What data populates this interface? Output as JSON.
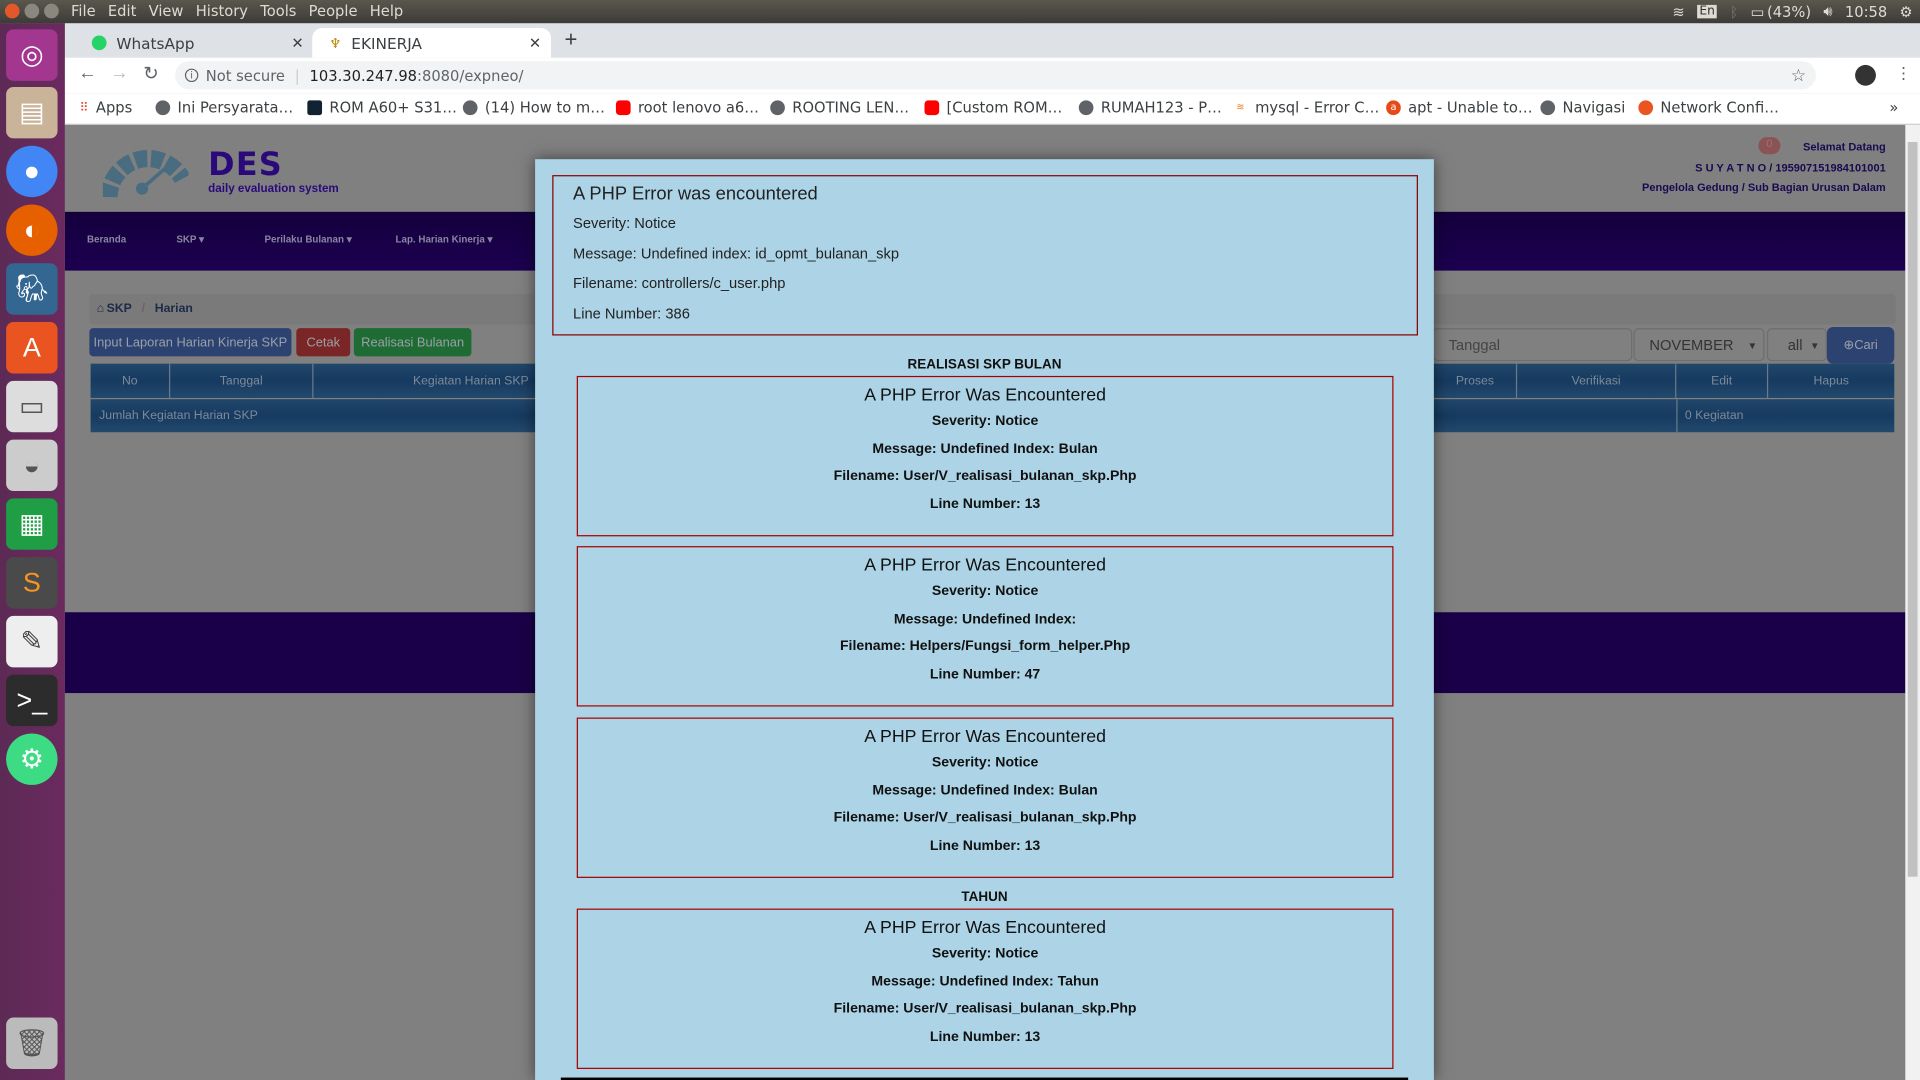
{
  "system": {
    "menu": [
      "File",
      "Edit",
      "View",
      "History",
      "Tools",
      "People",
      "Help"
    ],
    "keyboard": "En",
    "battery": "(43%)",
    "time": "10:58"
  },
  "browser": {
    "tabs": [
      {
        "label": "WhatsApp"
      },
      {
        "label": "EKINERJA"
      }
    ],
    "security": "Not secure",
    "url_host": "103.30.247.98",
    "url_rest": ":8080/expneo/",
    "bookmarks": [
      "Apps",
      "Ini Persyarata…",
      "ROM A60+ S31…",
      "(14) How to m…",
      "root lenovo a6…",
      "ROOTING LEN…",
      "[Custom ROM…",
      "RUMAH123 - P…",
      "mysql - Error C…",
      "apt - Unable to…",
      "Navigasi",
      "Network Confi…"
    ],
    "more": "»"
  },
  "site": {
    "logo_title": "DES",
    "logo_subtitle": "daily evaluation system",
    "badge": "0",
    "welcome": "Selamat Datang",
    "user": "S U Y A T N O / 195907151984101001",
    "position": "Pengelola Gedung / Sub Bagian Urusan Dalam",
    "nav": [
      "Beranda",
      "SKP",
      "Perilaku Bulanan",
      "Lap. Harian Kinerja"
    ],
    "breadcrumb": [
      "SKP",
      "Harian"
    ],
    "buttons": {
      "input": "Input Laporan Harian Kinerja SKP",
      "cetak": "Cetak",
      "realisasi": "Realisasi Bulanan",
      "cari": "Cari"
    },
    "filter": {
      "date_placeholder": "Tanggal",
      "month": "NOVEMBER",
      "status": "all"
    },
    "table": {
      "headers": [
        "No",
        "Tanggal",
        "Kegiatan Harian SKP",
        "Proses",
        "Verifikasi",
        "Edit",
        "Hapus"
      ],
      "footer_label": "Jumlah Kegiatan Harian SKP",
      "footer_count": "0 Kegiatan"
    }
  },
  "modal": {
    "top_error": {
      "title": "A PHP Error was encountered",
      "severity": "Severity: Notice",
      "message": "Message: Undefined index: id_opmt_bulanan_skp",
      "filename": "Filename: controllers/c_user.php",
      "line": "Line Number: 386"
    },
    "section1": "REALISASI SKP BULAN",
    "section2": "TAHUN",
    "errors": [
      {
        "title": "A PHP Error Was Encountered",
        "severity": "Severity: Notice",
        "message": "Message: Undefined Index: Bulan",
        "filename": "Filename: User/V_realisasi_bulanan_skp.Php",
        "line": "Line Number: 13"
      },
      {
        "title": "A PHP Error Was Encountered",
        "severity": "Severity: Notice",
        "message": "Message: Undefined Index:",
        "filename": "Filename: Helpers/Fungsi_form_helper.Php",
        "line": "Line Number: 47"
      },
      {
        "title": "A PHP Error Was Encountered",
        "severity": "Severity: Notice",
        "message": "Message: Undefined Index: Bulan",
        "filename": "Filename: User/V_realisasi_bulanan_skp.Php",
        "line": "Line Number: 13"
      },
      {
        "title": "A PHP Error Was Encountered",
        "severity": "Severity: Notice",
        "message": "Message: Undefined Index: Tahun",
        "filename": "Filename: User/V_realisasi_bulanan_skp.Php",
        "line": "Line Number: 13"
      }
    ]
  }
}
